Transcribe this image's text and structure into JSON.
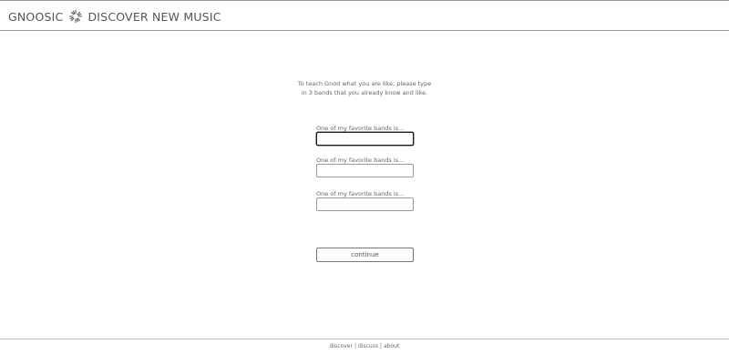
{
  "header": {
    "brand_name": "GNOOSIC",
    "logo_icon": "asterisk-burst-icon",
    "tagline": "DISCOVER NEW MUSIC"
  },
  "intro": {
    "line1": "To teach Gnod what you are like, please type",
    "line2": "in 3 bands that you already know and like."
  },
  "form": {
    "bands": [
      {
        "label": "One of my favorite bands is...",
        "value": ""
      },
      {
        "label": "One of my favorite bands is...",
        "value": ""
      },
      {
        "label": "One of my favorite bands is...",
        "value": ""
      }
    ],
    "continue_label": "continue"
  },
  "footer": {
    "links": [
      "discover",
      "discuss",
      "about"
    ],
    "separator": "|"
  },
  "colors": {
    "text": "#555555",
    "rule": "#9a9a9a",
    "background": "#ffffff"
  }
}
